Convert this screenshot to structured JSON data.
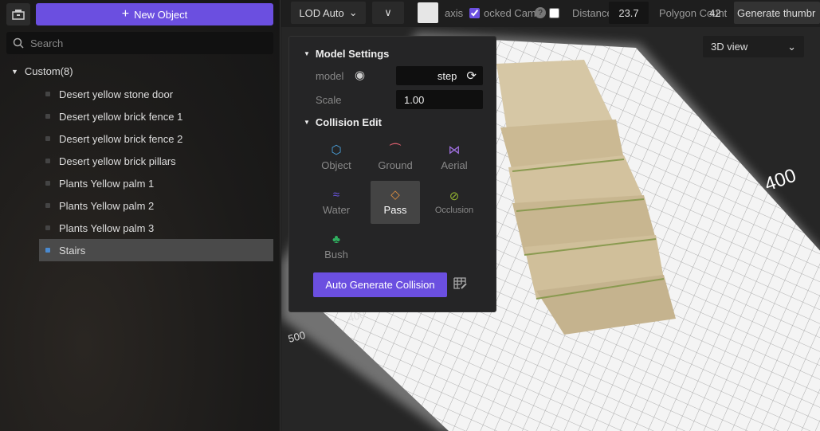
{
  "left": {
    "new_object": "New Object",
    "search_placeholder": "Search",
    "root": "Custom(8)",
    "items": [
      "Desert yellow stone door",
      "Desert yellow brick fence 1",
      "Desert yellow brick fence 2",
      "Desert yellow brick pillars",
      "Plants Yellow palm 1",
      "Plants Yellow palm 2",
      "Plants Yellow palm 3",
      "Stairs"
    ],
    "selected": "Stairs"
  },
  "toolbar": {
    "lod": "LOD Auto",
    "axis": "axis",
    "locked_camera": "ocked Cam",
    "distance_label": "Distance",
    "distance": "23.7",
    "polygon_label": "Polygon Count",
    "polygon": "42",
    "generate": "Generate thumbr"
  },
  "panel": {
    "model_settings": "Model Settings",
    "model_label": "model",
    "model_value": "step",
    "scale_label": "Scale",
    "scale_value": "1.00",
    "collision_edit": "Collision Edit",
    "buttons": [
      {
        "label": "Object",
        "color": "#4aa3df"
      },
      {
        "label": "Ground",
        "color": "#e06070"
      },
      {
        "label": "Aerial",
        "color": "#a070e0"
      },
      {
        "label": "Water",
        "color": "#6a55e0"
      },
      {
        "label": "Pass",
        "color": "#e09040"
      },
      {
        "label": "Occlusion",
        "color": "#90b030"
      },
      {
        "label": "Bush",
        "color": "#30b060"
      }
    ],
    "auto_generate": "Auto Generate Collision"
  },
  "viewport": {
    "view_mode": "3D view",
    "grid_labels": [
      "400",
      "400",
      "500"
    ]
  }
}
